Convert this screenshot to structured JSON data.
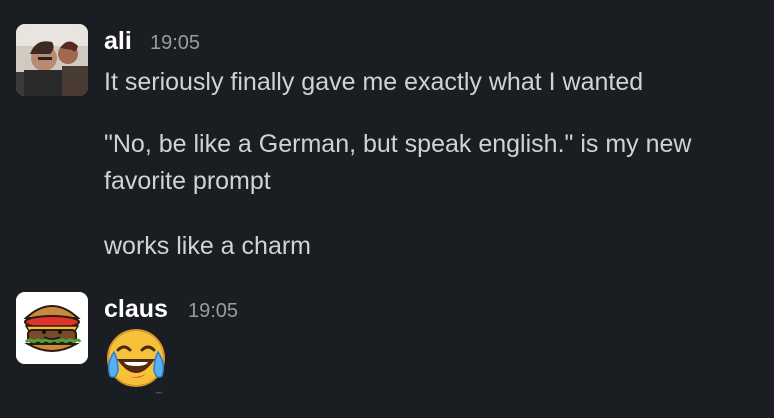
{
  "messages": [
    {
      "author": "ali",
      "time": "19:05",
      "lines": [
        "It seriously finally gave me exactly what I wanted",
        "\"No, be like a German, but speak english.\" is my new favorite prompt",
        "works like a charm"
      ],
      "avatar": "photo-avatar"
    },
    {
      "author": "claus",
      "time": "19:05",
      "emoji": "face-with-tears-of-joy-emoji",
      "avatar": "burger-face-avatar"
    }
  ],
  "colors": {
    "background": "#1a1d21",
    "text": "#d1d2d3",
    "name": "#ffffff",
    "timestamp": "#9a9b9d"
  }
}
